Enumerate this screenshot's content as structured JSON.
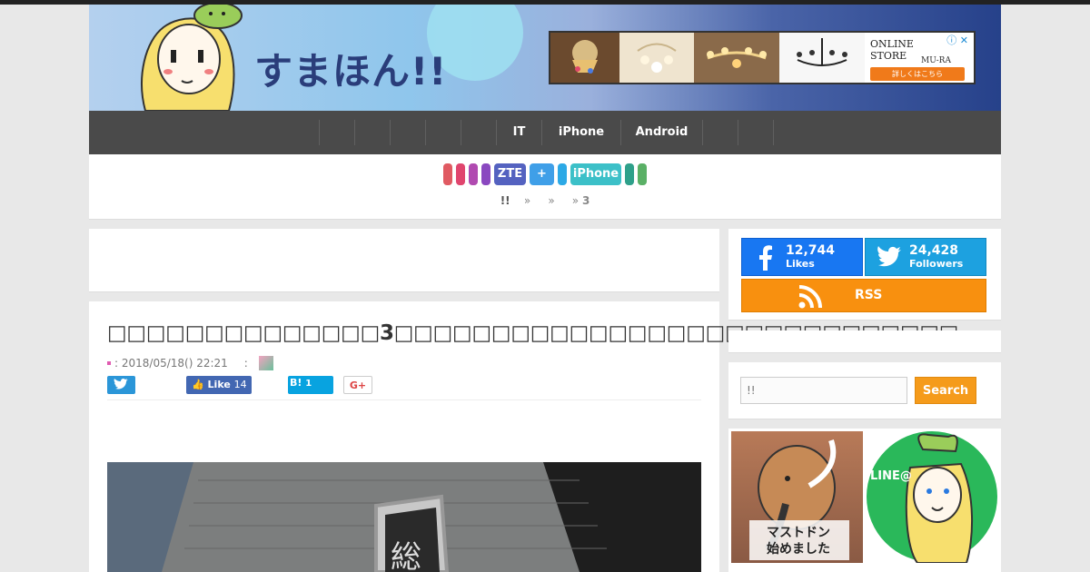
{
  "header": {
    "site_logo": "すまほん!!",
    "ad": {
      "store_line1": "ONLINE",
      "store_line2": "STORE",
      "brand": "MU-RA",
      "cta": "詳しくはこちら",
      "close": "ⓘ ✕"
    }
  },
  "nav": {
    "items": [
      "",
      "",
      "",
      "",
      "",
      "IT",
      "iPhone",
      "Android",
      "",
      ""
    ]
  },
  "tags": [
    {
      "label": "",
      "color": "#e05a62",
      "w": 10
    },
    {
      "label": "",
      "color": "#e0456e",
      "w": 10
    },
    {
      "label": "",
      "color": "#b04ab0",
      "w": 10
    },
    {
      "label": "",
      "color": "#8a48c0",
      "w": 10
    },
    {
      "label": "ZTE",
      "color": "#5462c0",
      "w": 35
    },
    {
      "label": "+",
      "color": "#3f9fe8",
      "w": 27
    },
    {
      "label": "",
      "color": "#2ca9e6",
      "w": 10
    },
    {
      "label": "iPhone",
      "color": "#3cc0c8",
      "w": 56
    },
    {
      "label": "",
      "color": "#2ea08a",
      "w": 10
    },
    {
      "label": "",
      "color": "#5ab066",
      "w": 10
    }
  ],
  "breadcrumb": {
    "home": "!!",
    "sep1": "»",
    "sep2": "»",
    "sep3": "»",
    "current": "3"
  },
  "article": {
    "title": "□□□□□□□□□□□□□□3□□□□□□□□□□□□□□□□□□□□□□□□□□□□□",
    "date_label": ": 2018/05/18() 22:21",
    "author_sep": ":",
    "share": {
      "like_label": "Like",
      "like_count": "14",
      "hatena_label": "B!",
      "hatena_count": "1",
      "gplus_label": "G+"
    }
  },
  "sidebar": {
    "facebook": {
      "count": "12,744",
      "label": "Likes"
    },
    "twitter": {
      "count": "24,428",
      "label": "Followers"
    },
    "rss": {
      "label": "RSS"
    },
    "search": {
      "placeholder": "!!",
      "button": "Search"
    },
    "banner1_text": "マストドン\n始めました",
    "banner2_text": "LINE@"
  },
  "colors": {
    "facebook": "#1877f2",
    "twitter": "#1da1e0",
    "rss": "#f8900f",
    "search": "#f59b1b"
  }
}
